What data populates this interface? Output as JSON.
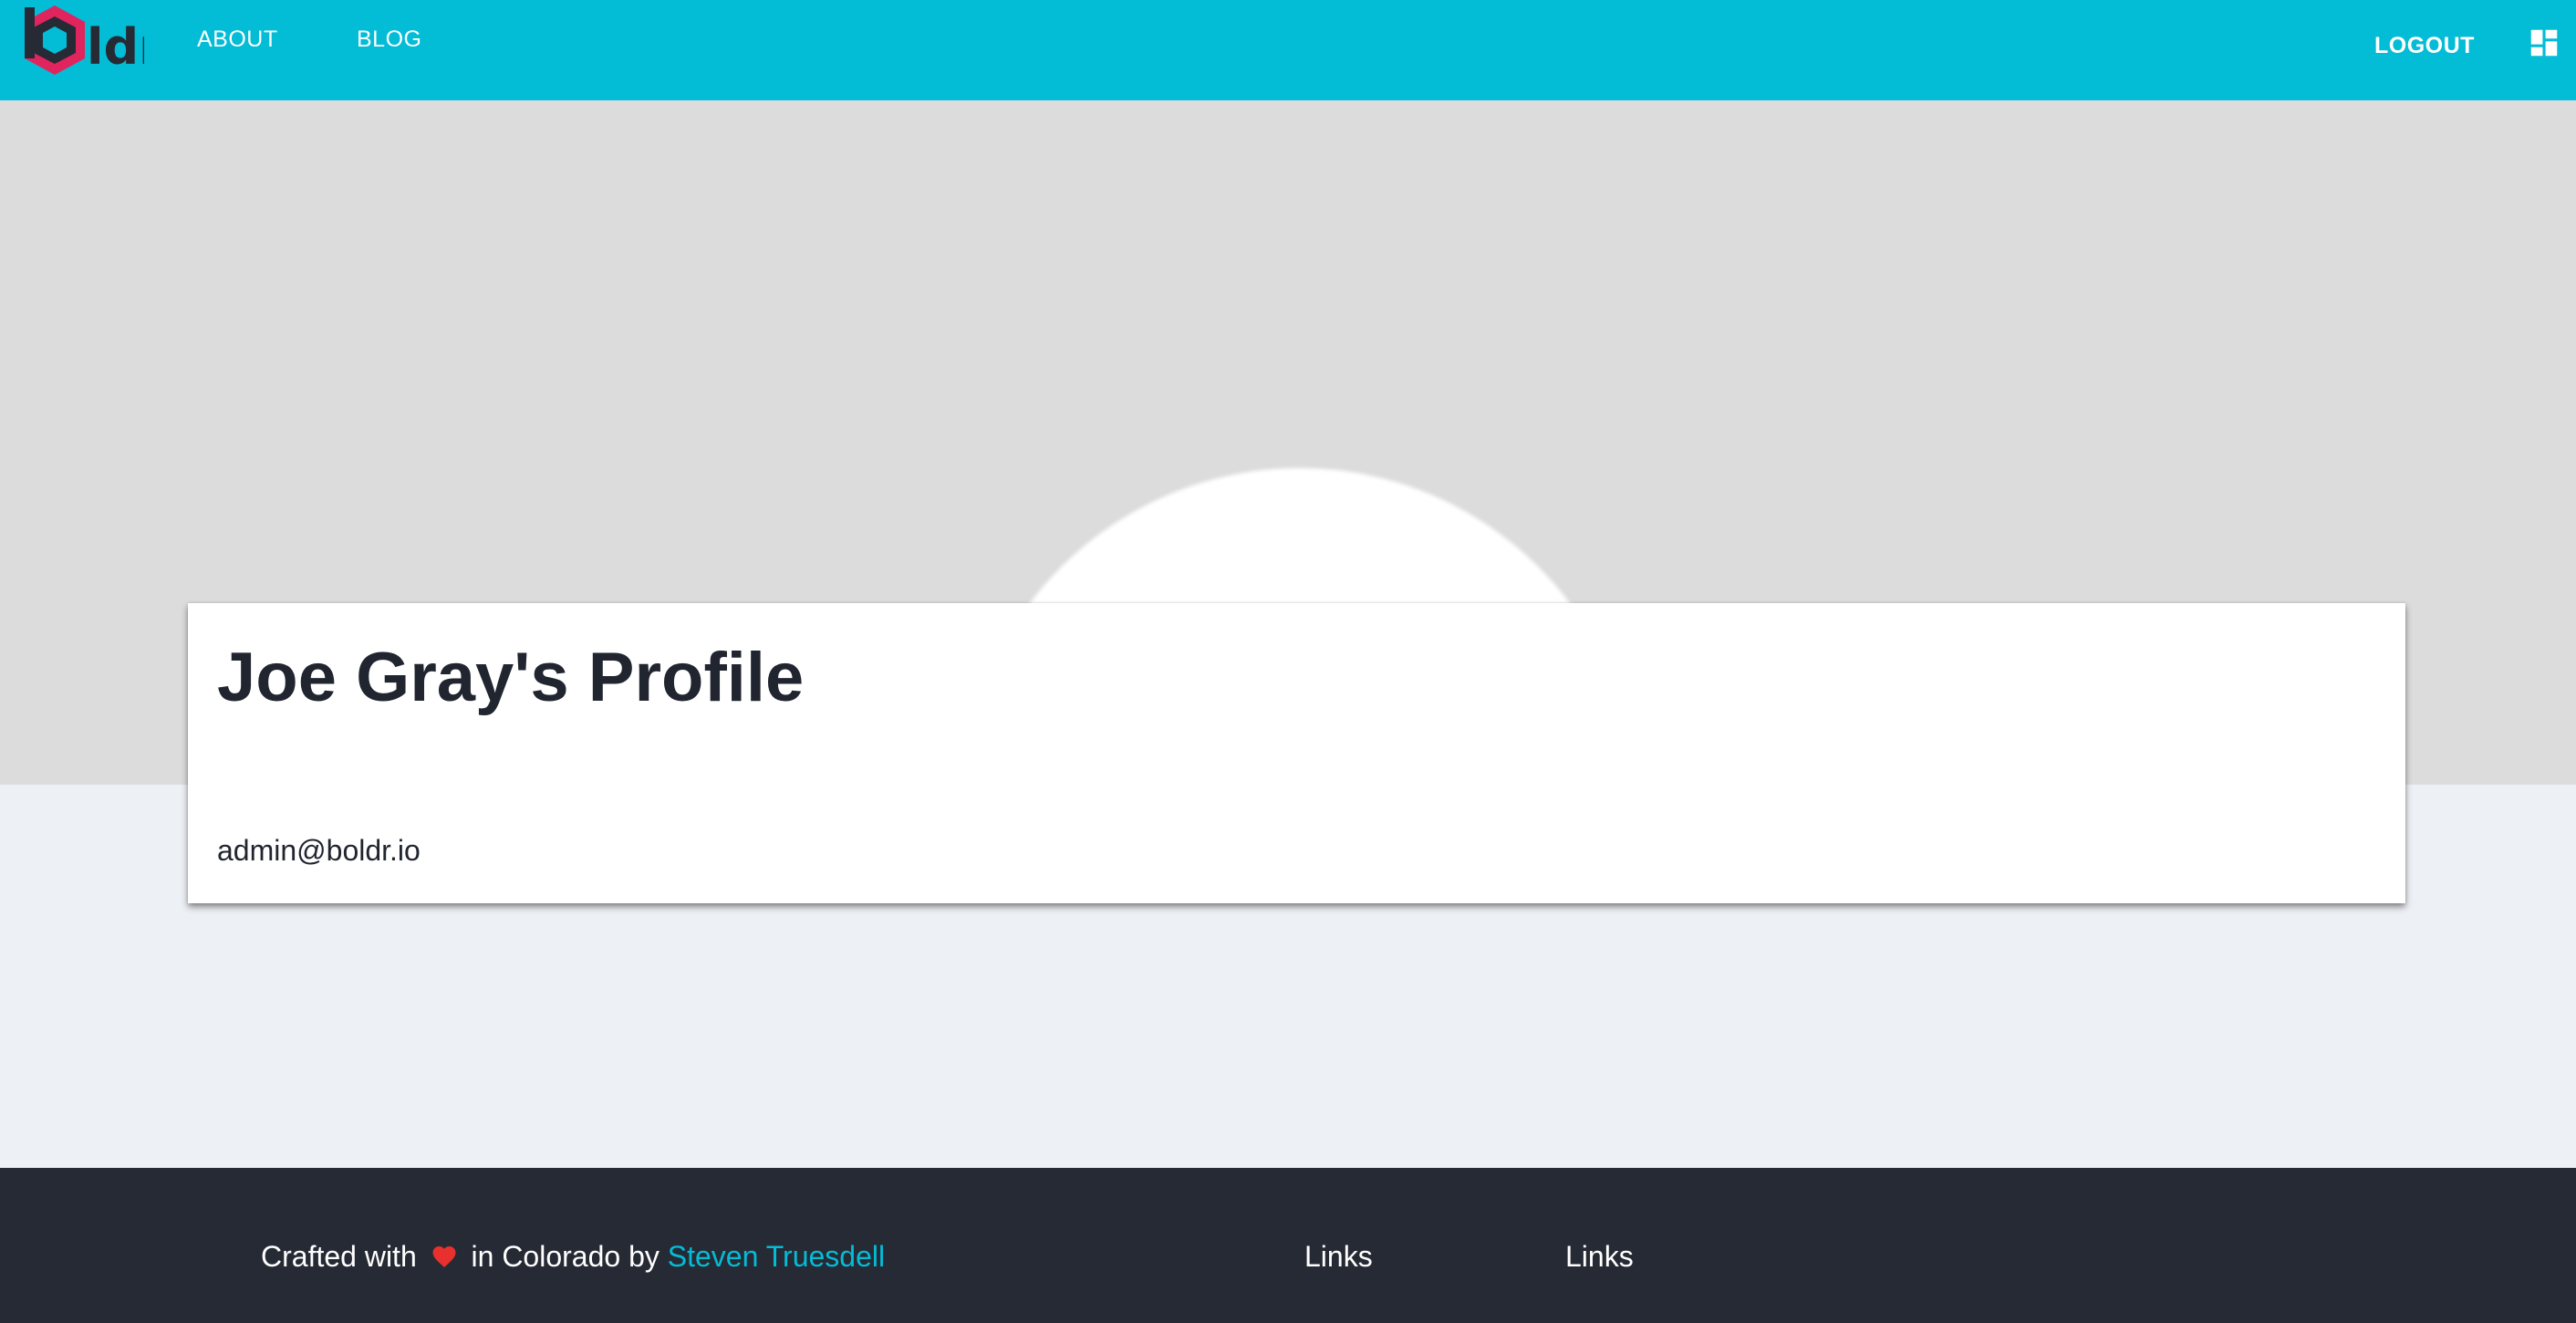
{
  "navbar": {
    "logo_text": "ldr",
    "items": [
      {
        "label": "ABOUT"
      },
      {
        "label": "BLOG"
      }
    ],
    "logout_label": "LOGOUT",
    "dashboard_icon": "dashboard-icon"
  },
  "profile": {
    "title": "Joe Gray's Profile",
    "email": "admin@boldr.io"
  },
  "footer": {
    "crafted_prefix": "Crafted with",
    "crafted_suffix": "in Colorado by",
    "author": "Steven Truesdell",
    "heart_icon": "heart-icon",
    "link_columns": [
      {
        "heading": "Links"
      },
      {
        "heading": "Links"
      }
    ]
  },
  "colors": {
    "brand_cyan": "#03bcd6",
    "logo_pink": "#e0245e",
    "dark": "#262a34",
    "hero_gray": "#dcdcdc",
    "page_bg": "#edf0f5"
  }
}
